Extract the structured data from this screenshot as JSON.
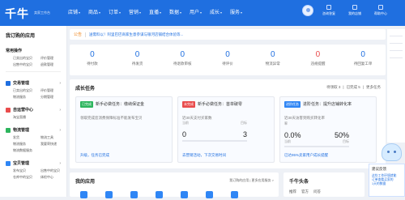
{
  "app": {
    "logo": "千牛",
    "logo_sub": "卖家工作台"
  },
  "nav": [
    "店铺",
    "商品",
    "订单",
    "营销",
    "直播",
    "数据",
    "用户",
    "成长",
    "服务"
  ],
  "user": {
    "shortcuts": [
      "咨询答复",
      "我的店铺",
      "帮助中心"
    ]
  },
  "sidebar": {
    "title": "我订购的应用",
    "common": {
      "head": "常用操作",
      "links": [
        "已卖出的宝贝",
        "评价管理",
        "出售中的宝贝",
        "退款管理"
      ]
    },
    "trade": {
      "head": "交易管理",
      "links": [
        "已卖出的宝贝",
        "评价管理",
        "物流服务",
        "分期管理"
      ]
    },
    "service": {
      "head": "自运营中心",
      "links": [
        "淘宝直播"
      ]
    },
    "logistics": {
      "head": "物流管理",
      "links": [
        "发货",
        "物流工具",
        "物流服务",
        "我要寄快递",
        "物流数据服务"
      ]
    },
    "shop": {
      "head": "宝贝管理",
      "links": [
        "发布宝贝",
        "出售中的宝贝",
        "仓库中的宝贝",
        "体检中心"
      ]
    }
  },
  "banner": {
    "tag": "公告",
    "text": "送需料以！阿里巴巴商家生意参谋与银河店铺结合体验等..."
  },
  "stats": [
    {
      "num": "0",
      "label": "待付款",
      "red": false
    },
    {
      "num": "0",
      "label": "待发货",
      "red": false
    },
    {
      "num": "0",
      "label": "待退款审核",
      "red": false
    },
    {
      "num": "0",
      "label": "待评价",
      "red": false
    },
    {
      "num": "0",
      "label": "物流异常",
      "red": false
    },
    {
      "num": "0",
      "label": "违规提醒",
      "red": true
    },
    {
      "num": "0",
      "label": "待回复工单",
      "red": false
    }
  ],
  "tasks": {
    "title": "成长任务",
    "tabs": [
      "待领取 3",
      "已完成 5",
      "更多任务"
    ],
    "cards": [
      {
        "badge": "已完成",
        "badge_color": "green",
        "title": "新手必做任务：缴纳保证金",
        "desc": "领取完成您消费保障标准不能发布宝贝",
        "link": "升级，任务已完成"
      },
      {
        "badge": "未完成",
        "badge_color": "red",
        "title": "新手必做任务：首单破零",
        "desc": "近30天支付买家数",
        "val_left": "0",
        "val_right": "3",
        "small_left": "当前",
        "small_right": "目标",
        "progress": 0,
        "link": "去营销活动，下次交易时间"
      },
      {
        "badge": "进阶任务",
        "badge_color": "blue",
        "title": "进阶任务：提升店铺转化率",
        "desc": "近30天访客到购买转化率",
        "sub": "率",
        "val_left": "0.0%",
        "val_right": "50%",
        "small_left": "当前",
        "small_right": "目标",
        "progress": 0,
        "link": "已达95%卖家用户成长提醒"
      }
    ]
  },
  "myapps": {
    "title": "我的应用",
    "links": "我订购的应用 | 更多应用服务 >"
  },
  "headlines": {
    "title": "千牛头条",
    "tabs": [
      "推荐",
      "官方",
      "问答"
    ]
  },
  "feedback": {
    "title": "建议反馈",
    "lines": [
      "这些工作环境就能",
      "订单查看买家的",
      "1天的数据"
    ]
  }
}
